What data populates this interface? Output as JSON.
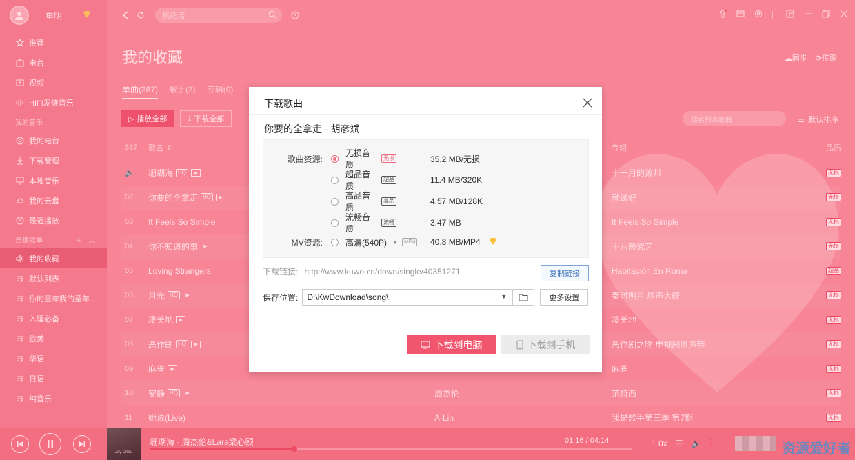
{
  "user": {
    "name": "重明"
  },
  "sidebar": {
    "items": [
      {
        "label": "推荐",
        "icon": "star-icon"
      },
      {
        "label": "电台",
        "icon": "radio-icon"
      },
      {
        "label": "视频",
        "icon": "video-icon"
      },
      {
        "label": "HIFI发烧音乐",
        "icon": "hifi-icon"
      }
    ],
    "my_music_title": "我的音乐",
    "my_music": [
      {
        "label": "我的电台",
        "icon": "radio-circle-icon"
      },
      {
        "label": "下载管理",
        "icon": "download-icon"
      },
      {
        "label": "本地音乐",
        "icon": "monitor-icon"
      },
      {
        "label": "我的云盘",
        "icon": "cloud-icon"
      },
      {
        "label": "最近播放",
        "icon": "clock-icon"
      }
    ],
    "playlists_title": "自建歌单",
    "playlists": [
      {
        "label": "我的收藏",
        "icon": "speaker-icon",
        "active": true
      },
      {
        "label": "默认列表",
        "icon": "playlist-icon"
      },
      {
        "label": "你的童年我的童年...",
        "icon": "playlist-icon"
      },
      {
        "label": "入睡必备",
        "icon": "playlist-icon"
      },
      {
        "label": "欧美",
        "icon": "playlist-icon"
      },
      {
        "label": "华语",
        "icon": "playlist-icon"
      },
      {
        "label": "日语",
        "icon": "playlist-icon"
      },
      {
        "label": "纯音乐",
        "icon": "playlist-icon"
      }
    ]
  },
  "topbar": {
    "search_value": "桃花诺"
  },
  "page": {
    "title": "我的收藏",
    "sync": "同步",
    "upload": "传歌",
    "tabs": [
      "单曲(387)",
      "歌手(3)",
      "专辑(0)"
    ],
    "play_all": "播放全部",
    "download_all": "下载全部",
    "list_search_placeholder": "搜索列表歌曲",
    "sort": "默认排序"
  },
  "list": {
    "count": "387",
    "col_name": "歌名",
    "col_album": "专辑",
    "col_quality": "品质",
    "rows": [
      {
        "idx": "",
        "name": "珊瑚海",
        "hq": true,
        "mv": true,
        "artist": "",
        "album": "十一月的萧邦",
        "quality": "无损"
      },
      {
        "idx": "02",
        "name": "你要的全拿走",
        "hq": true,
        "mv": true,
        "artist": "",
        "album": "就试好",
        "quality": "无损"
      },
      {
        "idx": "03",
        "name": "It Feels So Simple",
        "hq": false,
        "mv": false,
        "artist": "",
        "album": "It Feels So Simple",
        "quality": "无损"
      },
      {
        "idx": "04",
        "name": "你不知道的事",
        "hq": false,
        "mv": true,
        "artist": "",
        "album": "十八般武艺",
        "quality": "无损"
      },
      {
        "idx": "05",
        "name": "Loving Strangers",
        "hq": false,
        "mv": false,
        "artist": "",
        "album": "Habitación En Roma",
        "quality": "超品"
      },
      {
        "idx": "06",
        "name": "月光",
        "hq": true,
        "mv": true,
        "artist": "",
        "album": "秦时明月 原声大碟",
        "quality": "无损"
      },
      {
        "idx": "07",
        "name": "凄美地",
        "hq": false,
        "mv": true,
        "artist": "",
        "album": "凄美地",
        "quality": "无损"
      },
      {
        "idx": "08",
        "name": "恶作剧",
        "hq": true,
        "mv": true,
        "artist": "",
        "album": "恶作剧之吻 电视剧原声带",
        "quality": "无损"
      },
      {
        "idx": "09",
        "name": "麻雀",
        "hq": false,
        "mv": true,
        "artist": "",
        "album": "麻雀",
        "quality": "无损"
      },
      {
        "idx": "10",
        "name": "安静",
        "hq": true,
        "mv": true,
        "artist": "周杰伦",
        "album": "范特西",
        "quality": "无损"
      },
      {
        "idx": "11",
        "name": "她说(Live)",
        "hq": false,
        "mv": false,
        "artist": "A-Lin",
        "album": "我是歌手第三季 第7期",
        "quality": "无损"
      }
    ]
  },
  "player": {
    "now_playing": "珊瑚海 - 周杰伦&Lara梁心颐",
    "time": "01:16 / 04:14",
    "speed": "1.0x",
    "progress": 0.3,
    "watermark": "资源爱好者",
    "cover_text": "Jay Chou"
  },
  "dialog": {
    "title": "下载歌曲",
    "song": "你要的全拿走 - 胡彦斌",
    "source_label": "歌曲资源:",
    "sources": [
      {
        "name": "无损音质",
        "badge": "无损",
        "size": "35.2 MB/无损",
        "selected": true
      },
      {
        "name": "超品音质",
        "badge": "超品",
        "size": "11.4 MB/320K",
        "selected": false
      },
      {
        "name": "高品音质",
        "badge": "高品",
        "size": "4.57 MB/128K",
        "selected": false
      },
      {
        "name": "流畅音质",
        "badge": "流畅",
        "size": "3.47 MB",
        "selected": false
      }
    ],
    "mv_label": "MV资源:",
    "mv": {
      "name": "高清(540P)",
      "badge": "MP4",
      "size": "40.8 MB/MP4"
    },
    "link_label": "下载链接:",
    "link": "http://www.kuwo.cn/down/single/40351271",
    "copy": "复制链接",
    "save_label": "保存位置:",
    "save_path": "D:\\KwDownload\\song\\",
    "more_settings": "更多设置",
    "download_pc": "下载到电脑",
    "download_phone": "下载到手机",
    "colors": {
      "accent": "#f2566f",
      "app_bg": "#f58a9a"
    }
  }
}
